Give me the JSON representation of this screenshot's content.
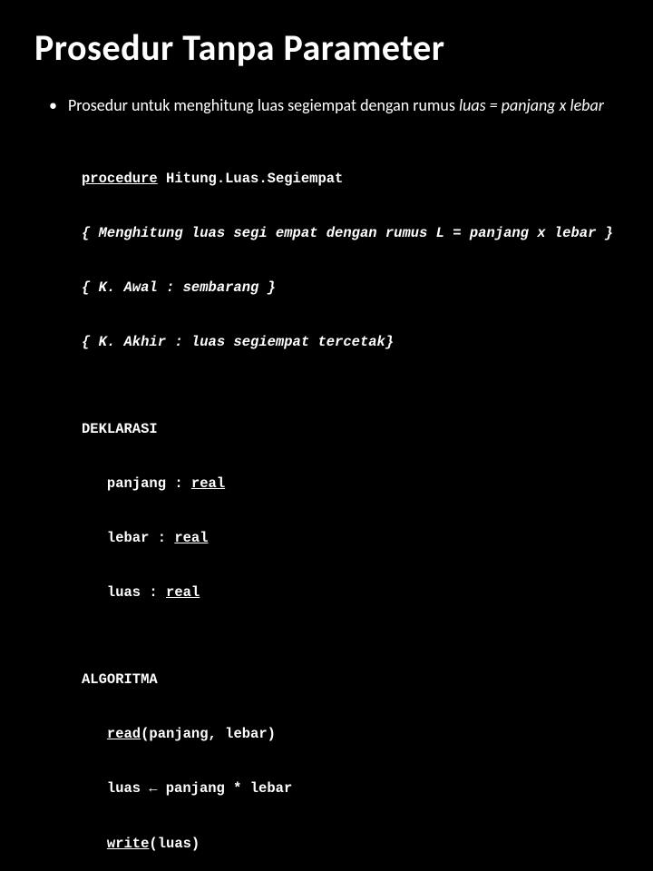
{
  "title": "Prosedur Tanpa Parameter",
  "bullet": {
    "marker": "•",
    "text_before": "Prosedur untuk menghitung luas segiempat dengan rumus ",
    "formula": "luas = panjang x lebar"
  },
  "code": {
    "proc_kw": "procedure",
    "proc_name": " Hitung.Luas.Segiempat",
    "c1": "{ Menghitung luas segi empat dengan rumus L = panjang x lebar }",
    "c2": "{ K. Awal : sembarang }",
    "c3": "{ K. Akhir : luas segiempat tercetak}",
    "dek_head": "DEKLARASI",
    "dek1_pre": "   panjang : ",
    "dek1_u": "real",
    "dek2_pre": "   lebar : ",
    "dek2_u": "real",
    "dek3_pre": "   luas : ",
    "dek3_u": "real",
    "alg_head": "ALGORITMA",
    "alg1_pre": "   ",
    "alg1_u": "read",
    "alg1_post": "(panjang, lebar)",
    "alg2_pre": "   luas ",
    "alg2_arrow": "←",
    "alg2_post": " panjang * lebar",
    "alg3_pre": "   ",
    "alg3_u": "write",
    "alg3_post": "(luas)"
  }
}
